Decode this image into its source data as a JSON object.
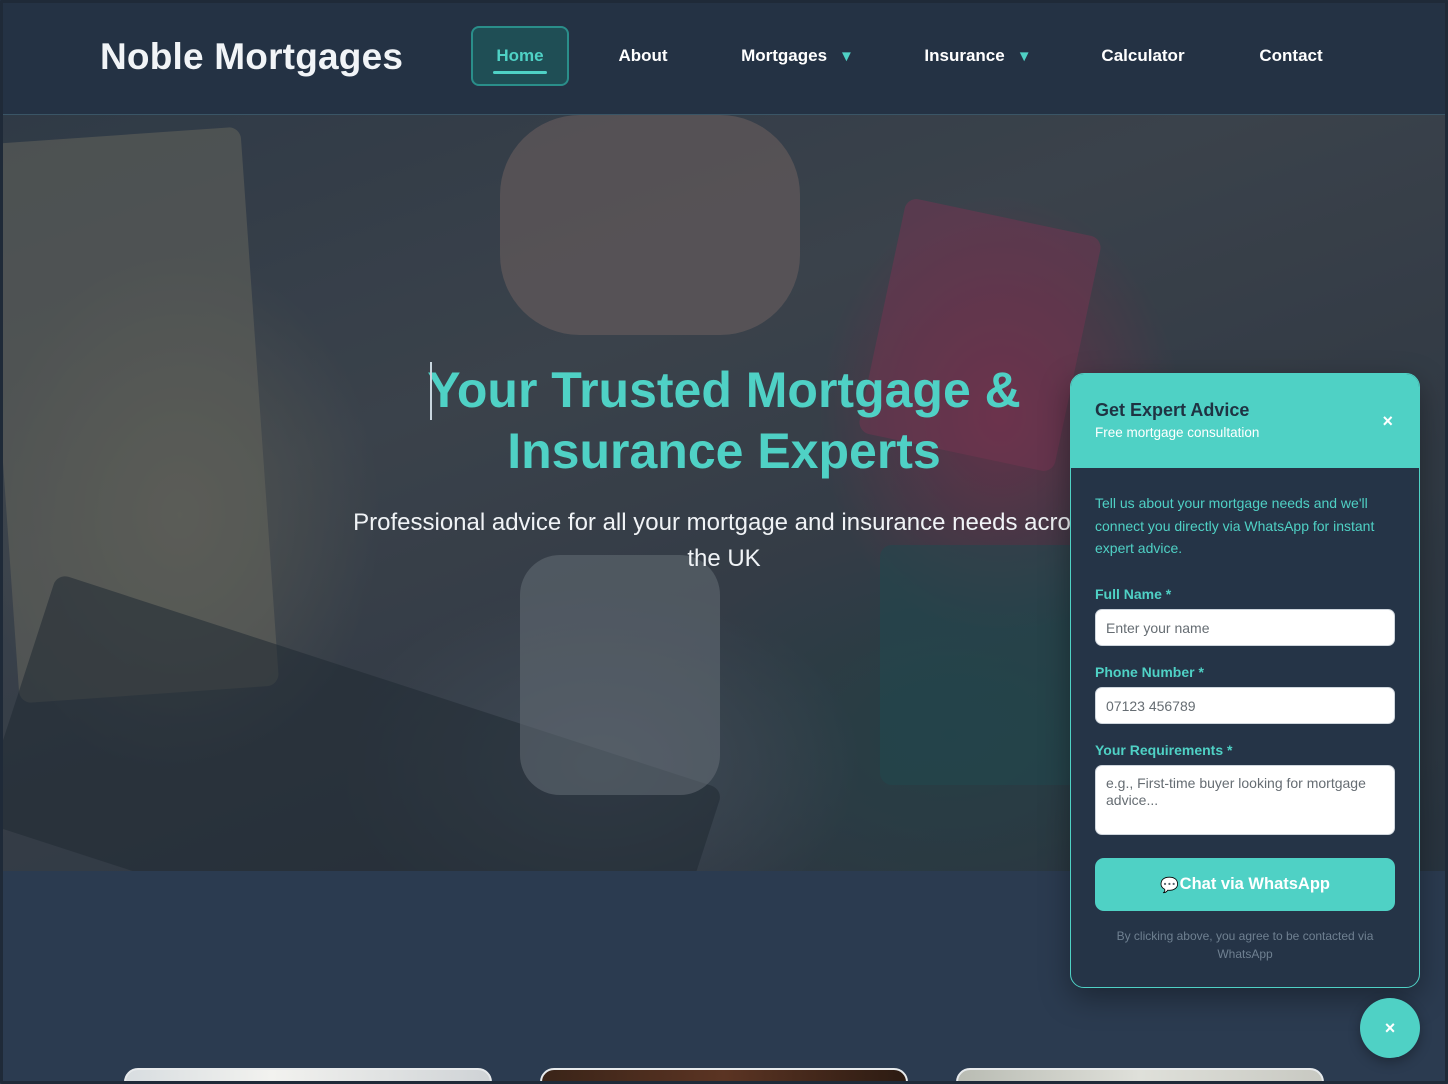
{
  "brand": "Noble Mortgages",
  "nav": {
    "home": "Home",
    "about": "About",
    "mortgages": "Mortgages",
    "insurance": "Insurance",
    "calculator": "Calculator",
    "contact": "Contact",
    "dropdown_caret": "▼"
  },
  "hero": {
    "title_line1": "Your Trusted Mortgage &",
    "title_line2": "Insurance Experts",
    "subtitle_line1": "Professional advice for all your mortgage and insurance needs across",
    "subtitle_line2": "the UK"
  },
  "popup": {
    "title": "Get Expert Advice",
    "subtitle": "Free mortgage consultation",
    "close_icon": "×",
    "intro": "Tell us about your mortgage needs and we'll connect you directly via WhatsApp for instant expert advice.",
    "name_label": "Full Name *",
    "name_placeholder": "Enter your name",
    "phone_label": "Phone Number *",
    "phone_placeholder": "07123 456789",
    "requirements_label": "Your Requirements *",
    "requirements_placeholder": "e.g., First-time buyer looking for mortgage advice...",
    "whatsapp_icon": "💬",
    "whatsapp_button": "Chat via WhatsApp",
    "disclaimer": "By clicking above, you agree to be contacted via WhatsApp"
  },
  "fab_icon": "×",
  "colors": {
    "accent": "#4fd1c5",
    "nav_bg": "#243244",
    "page_bg": "#2b3b50"
  }
}
